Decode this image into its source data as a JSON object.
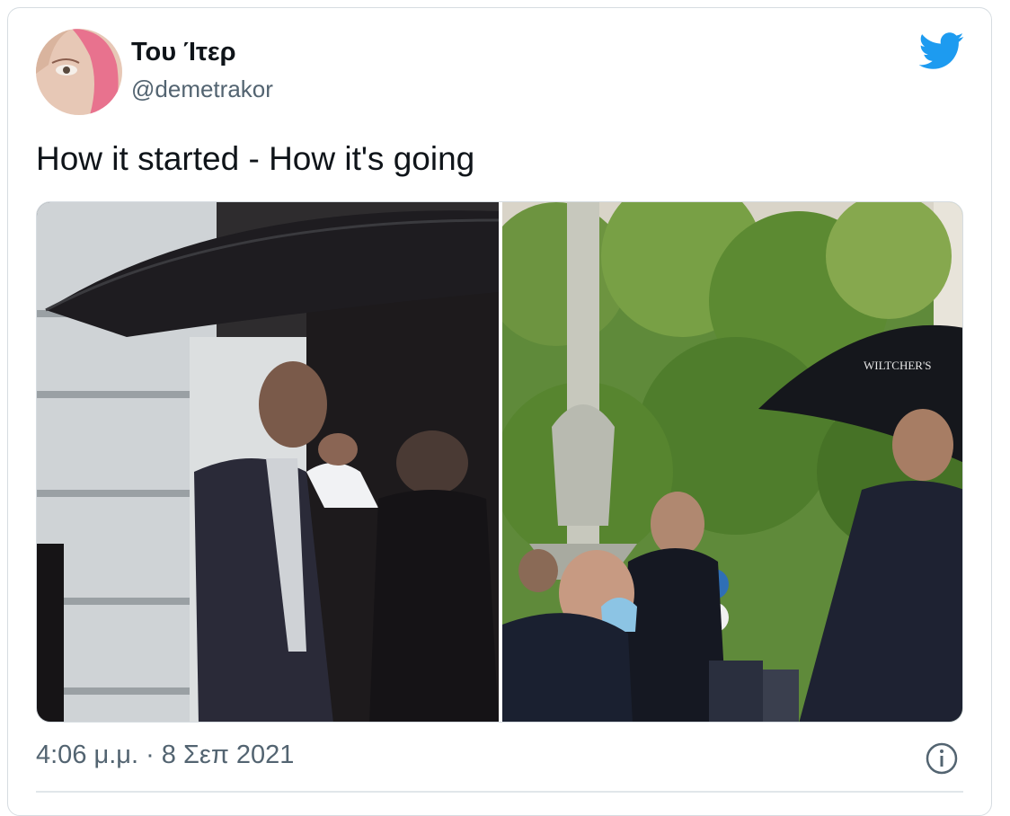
{
  "tweet": {
    "display_name": "Του Ίτερ",
    "handle": "@demetrakor",
    "text": "How it started - How it's going",
    "timestamp": "4:06 μ.μ. · 8 Σεπ 2021",
    "bird_icon": "twitter-bird-icon",
    "info_icon": "info-icon",
    "brand_color": "#1d9bf0",
    "umbrella_text": "WILTCHER'S"
  }
}
